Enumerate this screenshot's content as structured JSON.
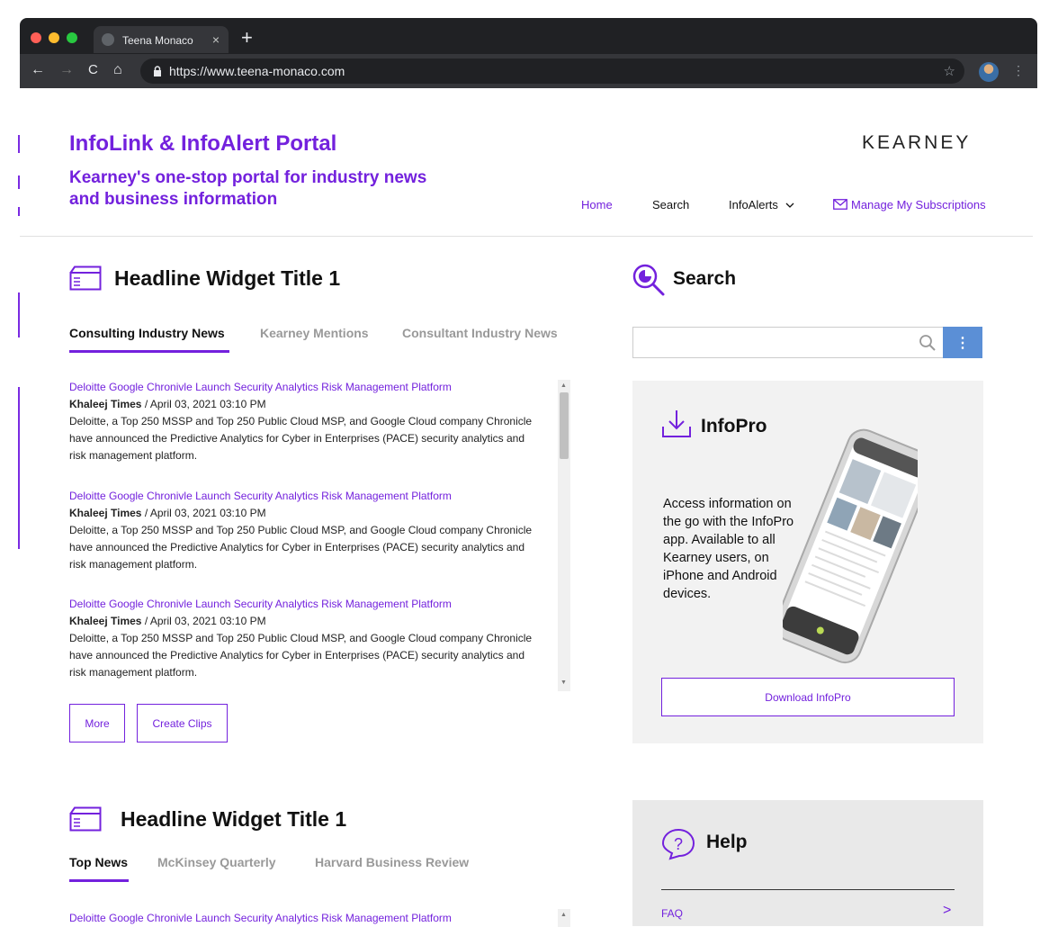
{
  "browser": {
    "tab_title": "Teena Monaco",
    "url": "https://www.teena-monaco.com"
  },
  "header": {
    "title": "InfoLink & InfoAlert Portal",
    "subtitle": "Kearney's one-stop portal for industry news and business information",
    "logo": "KEARNEY"
  },
  "nav": {
    "home": "Home",
    "search": "Search",
    "infoalerts": "InfoAlerts",
    "subscriptions": "Manage My Subscriptions"
  },
  "widget1": {
    "title": "Headline Widget Title 1",
    "tabs": [
      "Consulting Industry News",
      "Kearney Mentions",
      "Consultant Industry News"
    ],
    "articles": [
      {
        "headline": "Deloitte Google Chronivle Launch Security Analytics Risk Management Platform",
        "source": "Khaleej Times",
        "date": " / April 03, 2021 03:10 PM",
        "body": "Deloitte, a Top 250 MSSP and Top 250 Public Cloud MSP, and Google Cloud company Chronicle have announced the Predictive Analytics for Cyber in Enterprises (PACE) security analytics and risk management platform."
      },
      {
        "headline": "Deloitte Google Chronivle Launch Security Analytics Risk Management Platform",
        "source": "Khaleej Times",
        "date": " / April 03, 2021 03:10 PM",
        "body": "Deloitte, a Top 250 MSSP and Top 250 Public Cloud MSP, and Google Cloud company Chronicle have announced the Predictive Analytics for Cyber in Enterprises (PACE) security analytics and risk management platform."
      },
      {
        "headline": "Deloitte Google Chronivle Launch Security Analytics Risk Management Platform",
        "source": "Khaleej Times",
        "date": " / April 03, 2021 03:10 PM",
        "body": "Deloitte, a Top 250 MSSP and Top 250 Public Cloud MSP, and Google Cloud company Chronicle have announced the Predictive Analytics for Cyber in Enterprises (PACE) security analytics and risk management platform."
      }
    ],
    "more_label": "More",
    "clips_label": "Create Clips"
  },
  "widget2": {
    "title": "Headline Widget Title 1",
    "tabs": [
      "Top News",
      "McKinsey Quarterly",
      "Harvard Business Review"
    ],
    "article_headline": "Deloitte Google Chronivle Launch Security Analytics Risk Management Platform"
  },
  "search": {
    "title": "Search",
    "input_value": ""
  },
  "infopro": {
    "title": "InfoPro",
    "text": "Access information on the go with the InfoPro app. Available to all Kearney users, on iPhone and Android devices.",
    "button": "Download InfoPro"
  },
  "help": {
    "title": "Help",
    "faq": "FAQ"
  },
  "colors": {
    "accent": "#7321dd",
    "search_button": "#5b8fd6"
  }
}
